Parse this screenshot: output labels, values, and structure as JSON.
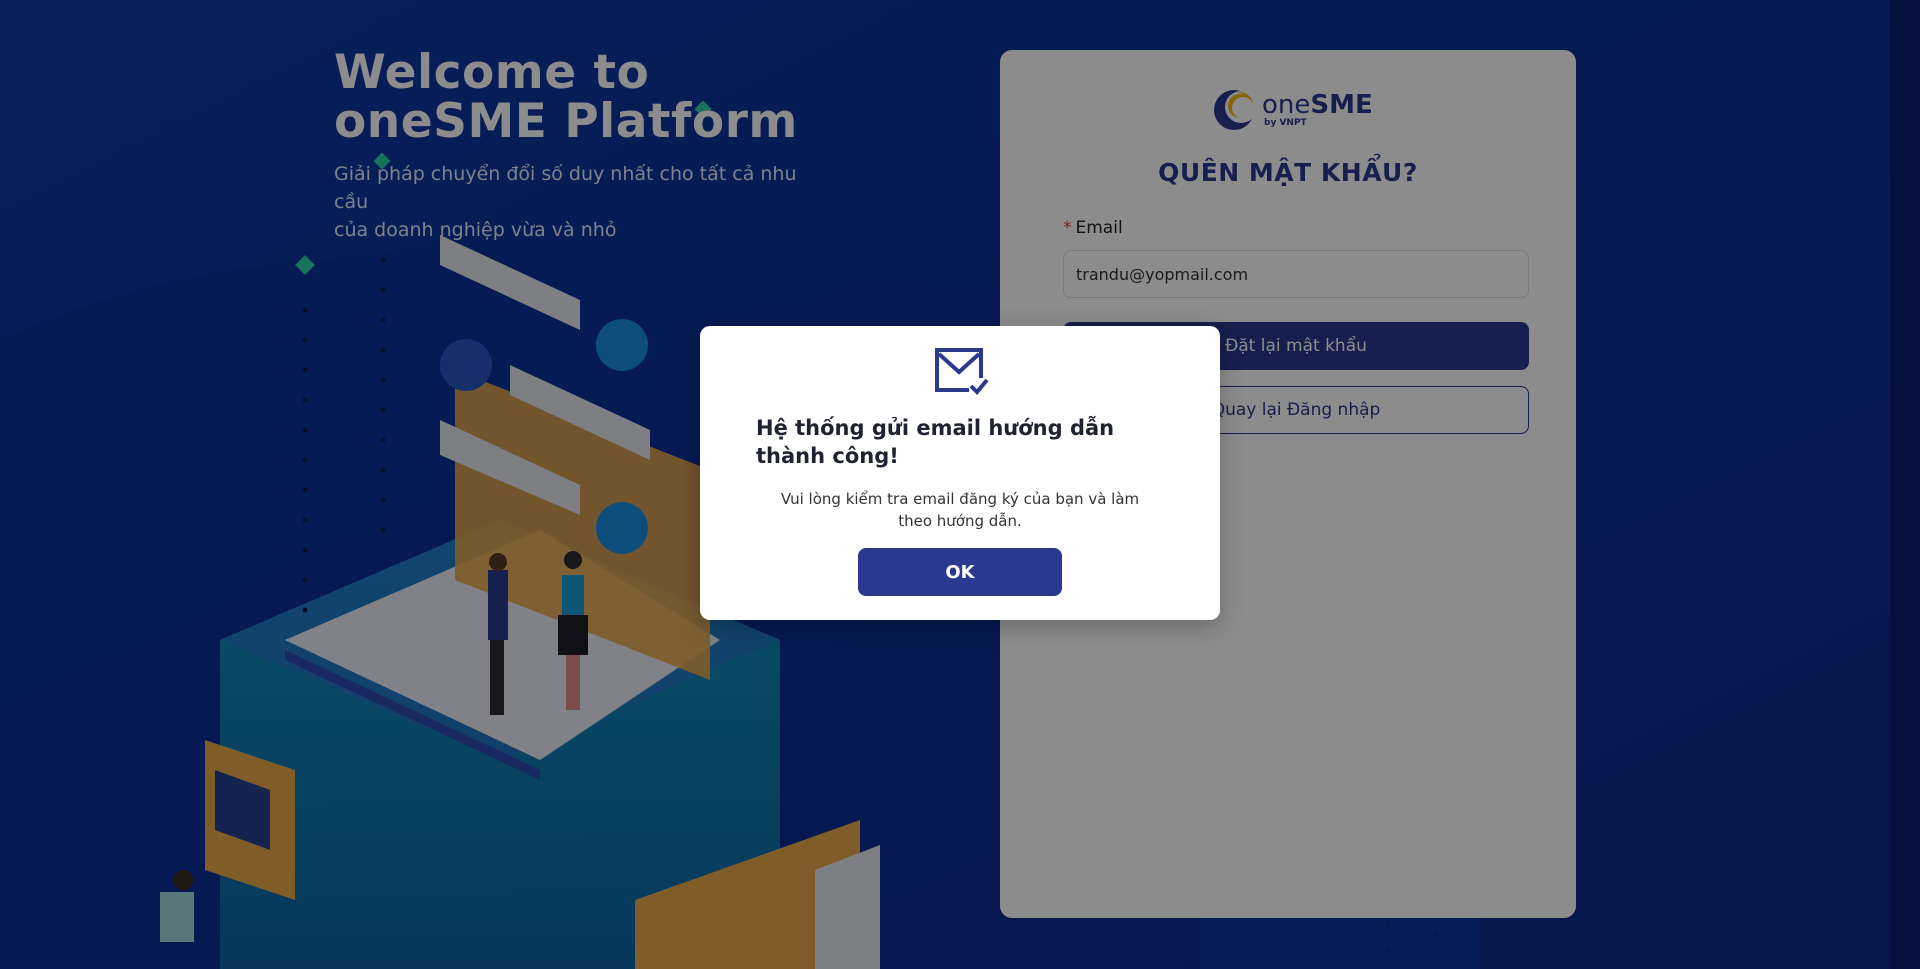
{
  "hero": {
    "title_line1": "Welcome to",
    "title_line2": "oneSME Platform",
    "subtitle_line1": "Giải pháp chuyển đổi số duy nhất cho tất cả nhu cầu",
    "subtitle_line2": "của doanh nghiệp vừa và nhỏ"
  },
  "card": {
    "logo_one": "one",
    "logo_sme": "SME",
    "logo_by": "by VNPT",
    "title": "QUÊN MẬT KHẨU?",
    "email_label": "Email",
    "email_required_mark": "*",
    "email_value": "trandu@yopmail.com",
    "reset_button": "Đặt lại mật khẩu",
    "back_button": "Quay lại Đăng nhập"
  },
  "modal": {
    "icon": "mail-check-icon",
    "title": "Hệ thống gửi email hướng dẫn thành công!",
    "message": "Vui lòng kiểm tra email đăng ký của bạn và làm theo hướng dẫn.",
    "ok_button": "OK"
  },
  "colors": {
    "brand_blue": "#2b3a8f",
    "background_blue": "#0a2b8a",
    "logo_gold": "#f2b705"
  }
}
